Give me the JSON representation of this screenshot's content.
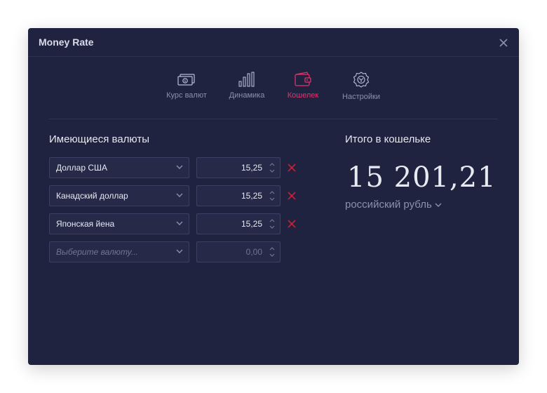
{
  "window": {
    "title": "Money Rate"
  },
  "tabs": [
    {
      "label": "Курс валют",
      "icon": "banknote-icon"
    },
    {
      "label": "Динамика",
      "icon": "bar-chart-icon"
    },
    {
      "label": "Кошелек",
      "icon": "wallet-icon",
      "active": true
    },
    {
      "label": "Настройки",
      "icon": "gear-icon"
    }
  ],
  "currencies": {
    "title": "Имеющиеся валюты",
    "rows": [
      {
        "currency": "Доллар США",
        "amount": "15,25"
      },
      {
        "currency": "Канадский доллар",
        "amount": "15,25"
      },
      {
        "currency": "Японская йена",
        "amount": "15,25"
      }
    ],
    "new_row": {
      "placeholder": "Выберите валюту...",
      "amount_placeholder": "0,00"
    }
  },
  "wallet": {
    "title": "Итого в кошельке",
    "total": "15 201,21",
    "currency": "российский рубль"
  },
  "colors": {
    "background": "#1f2340",
    "accent": "#e8326c",
    "remove": "#c41e3a"
  }
}
